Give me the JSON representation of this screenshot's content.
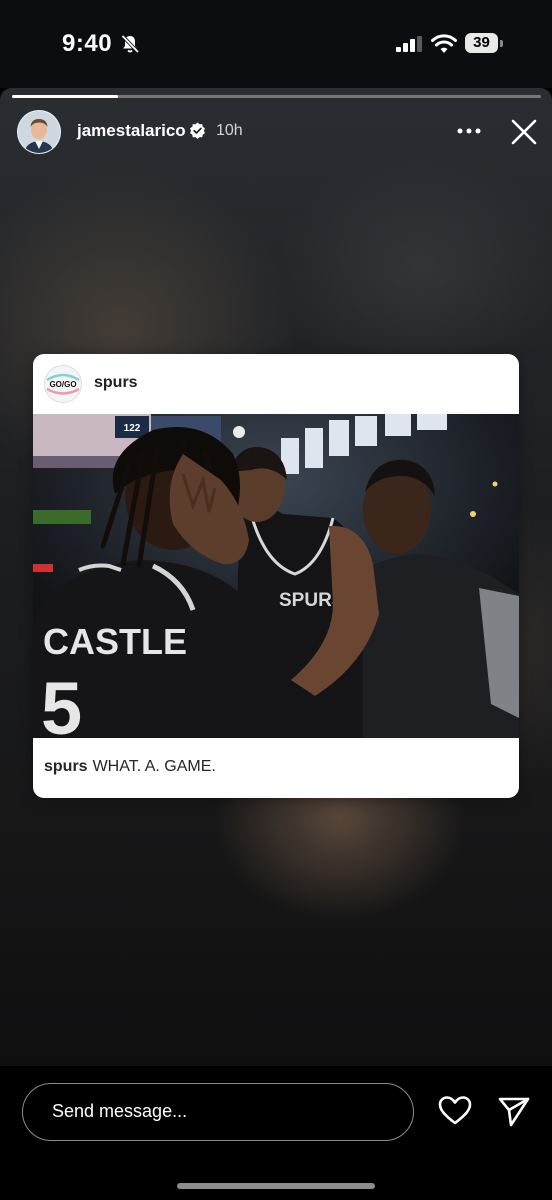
{
  "status_bar": {
    "time": "9:40",
    "battery": "39",
    "icons": [
      "bell-slash-icon",
      "cellular-signal-icon",
      "wifi-icon",
      "battery-icon"
    ]
  },
  "story": {
    "progress": 0.2,
    "username": "jamestalarico",
    "verified": true,
    "age": "10h",
    "icons": [
      "more-icon",
      "close-icon"
    ]
  },
  "shared_post": {
    "account": "spurs",
    "logo_text": "GO/GO",
    "caption_user": "spurs",
    "caption_text": "WHAT. A. GAME.",
    "photo": {
      "jersey_name": "CASTLE",
      "jersey_number": "5",
      "scoreboard_number": "122",
      "jersey_brand": "SPURS"
    }
  },
  "reply_bar": {
    "placeholder": "Send message...",
    "icons": [
      "heart-icon",
      "send-icon"
    ]
  },
  "colors": {
    "background": "#000000",
    "card": "#ffffff",
    "caption_text": "#262626"
  }
}
